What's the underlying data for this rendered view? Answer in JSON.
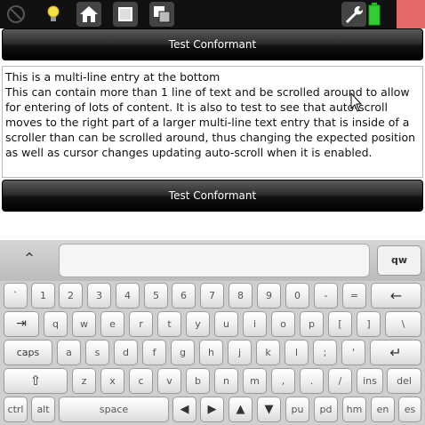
{
  "topbar": {
    "icons": [
      "disabled-icon",
      "bulb-icon",
      "home-icon",
      "window-icon",
      "windows-icon",
      "wrench-icon",
      "battery-icon",
      "close-icon"
    ]
  },
  "conformant": {
    "top_label": "Test Conformant",
    "bottom_label": "Test Conformant"
  },
  "entry": {
    "line1": "This is a multi-line entry at the bottom",
    "line2": "This can contain more than 1 line of text and be scrolled around to allow for entering of lots of content. It is also to test to see that auto-scroll moves to the right part of a larger multi-line text entry that is inside of a scroller than can be scrolled around, thus changing the expected position as well as cursor changes updating auto-scroll when it is enabled."
  },
  "keyboard": {
    "caret": "⌃",
    "lang": "qw",
    "row1": [
      "`",
      "1",
      "2",
      "3",
      "4",
      "5",
      "6",
      "7",
      "8",
      "9",
      "0",
      "-",
      "=",
      "←"
    ],
    "row2": [
      "⇥",
      "q",
      "w",
      "e",
      "r",
      "t",
      "y",
      "u",
      "i",
      "o",
      "p",
      "[",
      "]",
      "\\"
    ],
    "row3": [
      "caps",
      "a",
      "s",
      "d",
      "f",
      "g",
      "h",
      "j",
      "k",
      "l",
      ";",
      "'",
      "↵"
    ],
    "row4": [
      "⇧",
      "z",
      "x",
      "c",
      "v",
      "b",
      "n",
      "m",
      ",",
      ".",
      "/",
      "ins",
      "del"
    ],
    "row5": [
      "ctrl",
      "alt",
      "space",
      "◀",
      "▶",
      "▲",
      "▼",
      "pu",
      "pd",
      "hm",
      "en",
      "es"
    ]
  }
}
